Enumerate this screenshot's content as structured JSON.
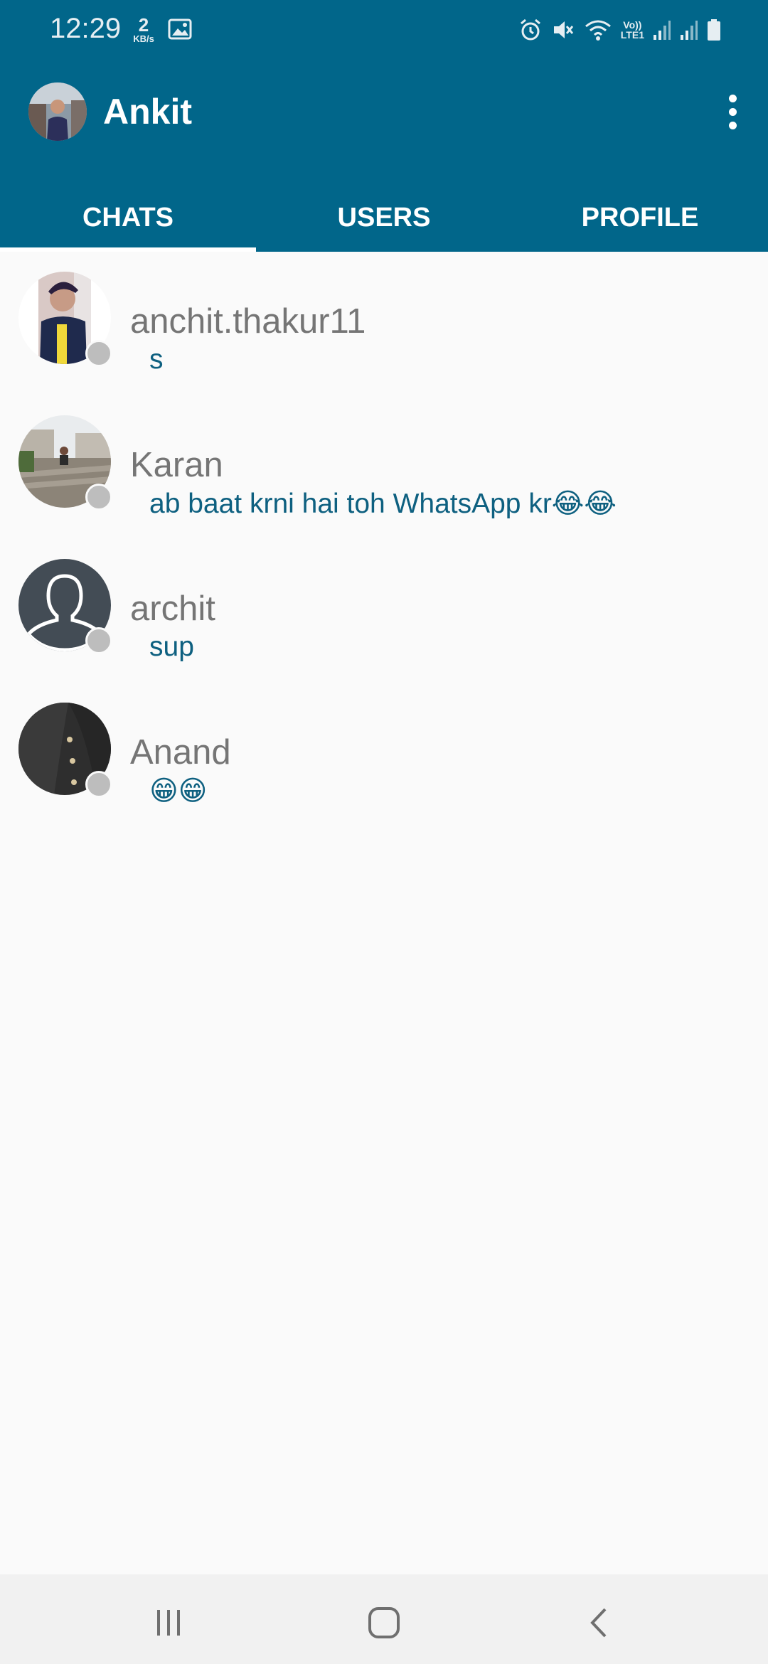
{
  "status_bar": {
    "time": "12:29",
    "speed_value": "2",
    "speed_unit": "KB/s",
    "volte_top": "Vo))",
    "volte_bottom": "LTE1",
    "icons": [
      "image-icon",
      "alarm-icon",
      "mute-icon",
      "wifi-icon",
      "signal-icon",
      "signal-icon",
      "battery-icon"
    ]
  },
  "app_bar": {
    "title": "Ankit",
    "menu_icon": "more-vert-icon",
    "color": "#01668a"
  },
  "tabs": [
    {
      "label": "CHATS",
      "active": true
    },
    {
      "label": "USERS",
      "active": false
    },
    {
      "label": "PROFILE",
      "active": false
    }
  ],
  "chats": [
    {
      "name": "anchit.thakur11",
      "message": "s",
      "online": false
    },
    {
      "name": "Karan",
      "message": "ab baat krni hai toh WhatsApp kr😂😂",
      "online": false
    },
    {
      "name": "archit",
      "message": "sup",
      "online": false
    },
    {
      "name": "Anand",
      "message": "😁😁",
      "online": false
    }
  ],
  "nav_bar": {
    "buttons": [
      "recents-icon",
      "home-icon",
      "back-icon"
    ]
  },
  "colors": {
    "accent": "#01668a",
    "message_text": "#0e6080",
    "name_text": "#757575",
    "offline_dot": "#bdbdbd"
  }
}
